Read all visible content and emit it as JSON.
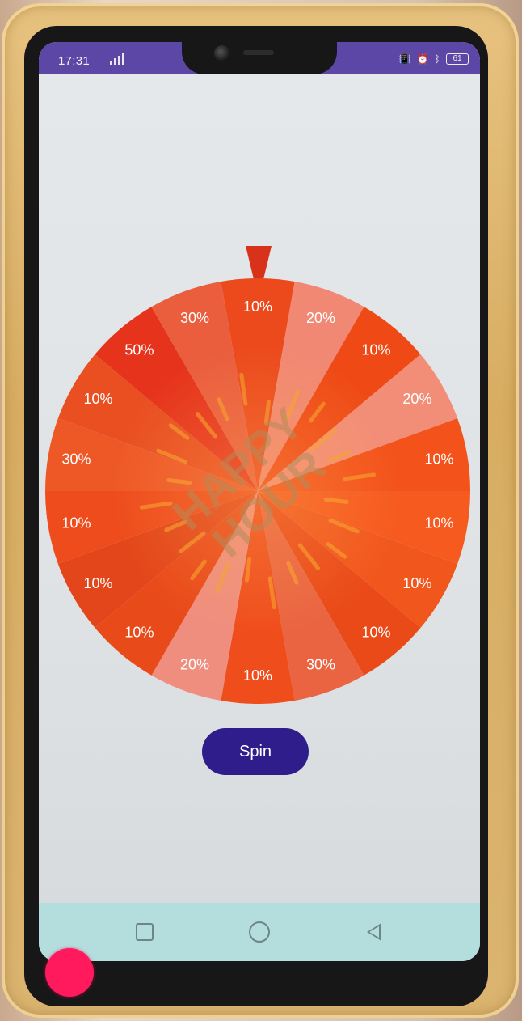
{
  "status_bar": {
    "time": "17:31",
    "battery": "61",
    "icons": [
      "signal-icon",
      "vibrate-icon",
      "alarm-icon",
      "bluetooth-icon",
      "battery-icon"
    ]
  },
  "wheel": {
    "watermark_lines": [
      "HAPPY",
      "HOUR"
    ],
    "segments": [
      "10%",
      "20%",
      "10%",
      "20%",
      "10%",
      "10%",
      "10%",
      "10%",
      "30%",
      "10%",
      "20%",
      "10%",
      "10%",
      "10%",
      "30%",
      "10%",
      "50%",
      "30%"
    ],
    "colors": [
      "#ec4a1c",
      "#f18873",
      "#ef4a16",
      "#f28d78",
      "#f3521a",
      "#f65a1e",
      "#f1571d",
      "#ea4a18",
      "#ea6441",
      "#ef4d1c",
      "#ef8e7e",
      "#e94a1a",
      "#e3461a",
      "#ee4c1c",
      "#ee5827",
      "#e94f21",
      "#e6341c",
      "#ea5e3e"
    ]
  },
  "spin_button": {
    "label": "Spin"
  },
  "nav_bar": {
    "icons": [
      "recents-icon",
      "home-icon",
      "back-icon"
    ]
  },
  "colors": {
    "accent": "#2e1d8a",
    "status_bar": "#5d47a6",
    "pointer": "#d9321b",
    "nav_bar": "#b4dede",
    "touch_indicator": "#ff1a5e"
  }
}
